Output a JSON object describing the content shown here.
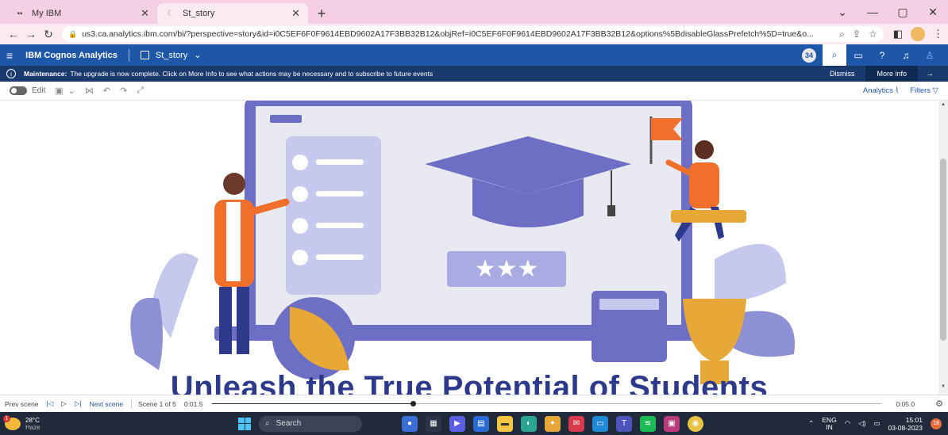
{
  "browser": {
    "tabs": [
      {
        "title": "My IBM",
        "favicon": "ibm-icon"
      },
      {
        "title": "St_story",
        "favicon": "cognos-icon"
      }
    ],
    "new_tab": "+",
    "url": "us3.ca.analytics.ibm.com/bi/?perspective=story&id=i0C5EF6F0F9614EBD9602A17F3BB32B12&objRef=i0C5EF6F0F9614EBD9602A17F3BB32B12&options%5BdisableGlassPrefetch%5D=true&o..."
  },
  "app": {
    "brand": "IBM Cognos Analytics",
    "story_name": "St_story",
    "user_badge": "34"
  },
  "banner": {
    "label": "Maintenance:",
    "message": "The upgrade is now complete. Click on More Info to see what actions may be necessary and to subscribe to future events",
    "dismiss": "Dismiss",
    "more_info": "More info"
  },
  "toolbar": {
    "edit_label": "Edit",
    "analytics_label": "Analytics",
    "filters_label": "Filters"
  },
  "canvas": {
    "headline": "Unleash the True Potential of Students",
    "illustration": "education-illustration",
    "colors": {
      "purple": "#6c6fc4",
      "lavender": "#c7c8ee",
      "orange": "#f06f2a",
      "gold": "#e8a838",
      "navy": "#2d3a8c"
    }
  },
  "playback": {
    "prev_scene": "Prev scene",
    "next_scene": "Next scene",
    "scene_label": "Scene 1 of 5",
    "current_time": "0:01.5",
    "end_time": "0:05.0",
    "progress": 0.3
  },
  "taskbar": {
    "temp": "28°C",
    "weather": "Haze",
    "search": "Search",
    "lang_top": "ENG",
    "lang_bottom": "IN",
    "time": "15:01",
    "date": "03-08-2023",
    "notifications": "18"
  }
}
